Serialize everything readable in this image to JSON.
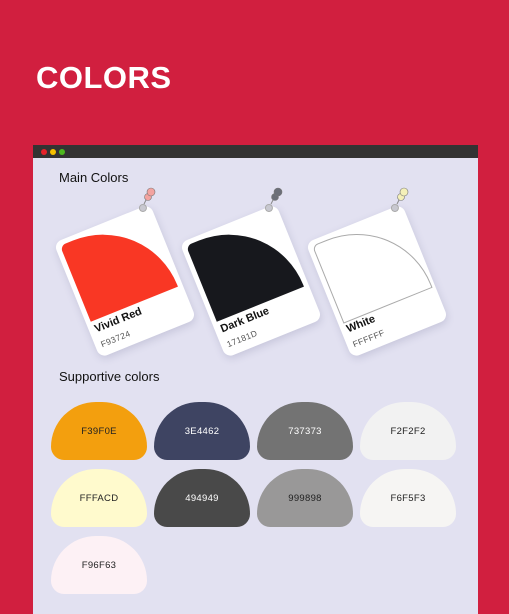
{
  "page": {
    "title": "COLORS"
  },
  "window": {
    "traffic_lights": [
      "#E5222A",
      "#F5C000",
      "#4DB81F"
    ]
  },
  "main_colors": {
    "title": "Main  Colors",
    "cards": [
      {
        "name": "Vivid Red",
        "code": "F93724",
        "color": "#F93724",
        "pin_color": "#F3A3A0",
        "outlined": false
      },
      {
        "name": "Dark Blue",
        "code": "17181D",
        "color": "#17181D",
        "pin_color": "#6B6E78",
        "outlined": false
      },
      {
        "name": "White",
        "code": "FFFFFF",
        "color": "#FFFFFF",
        "pin_color": "#F4F0B8",
        "outlined": true
      }
    ]
  },
  "supportive_colors": {
    "title": "Supportive colors",
    "chips": [
      {
        "code": "F39F0E",
        "color": "#F39F0E",
        "text_color": "#222222"
      },
      {
        "code": "3E4462",
        "color": "#3E4462",
        "text_color": "#ffffff"
      },
      {
        "code": "737373",
        "color": "#737373",
        "text_color": "#ffffff"
      },
      {
        "code": "F2F2F2",
        "color": "#F2F2F2",
        "text_color": "#222222"
      },
      {
        "code": "FFFACD",
        "color": "#FFFACD",
        "text_color": "#222222"
      },
      {
        "code": "494949",
        "color": "#494949",
        "text_color": "#ffffff"
      },
      {
        "code": "999898",
        "color": "#999898",
        "text_color": "#222222"
      },
      {
        "code": "F6F5F3",
        "color": "#F6F5F3",
        "text_color": "#222222"
      },
      {
        "code": "F96F63",
        "color": "#FDF1F5",
        "text_color": "#222222"
      }
    ]
  }
}
